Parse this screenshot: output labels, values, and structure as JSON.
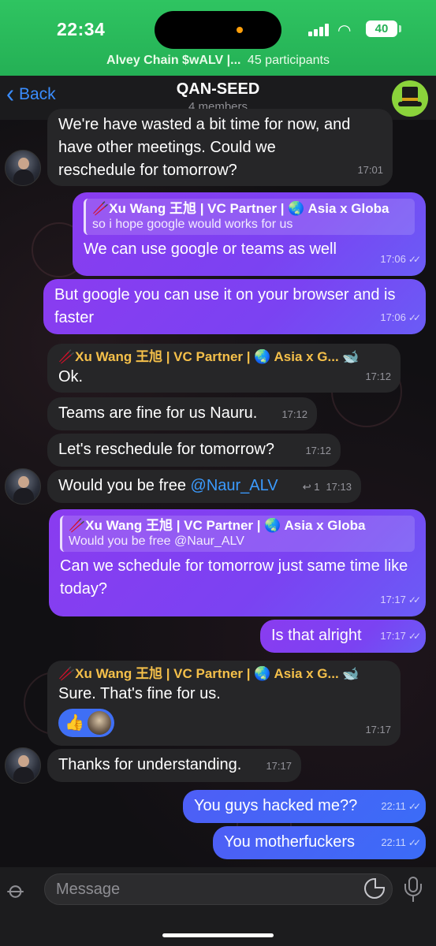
{
  "status_bar": {
    "time": "22:34",
    "battery": "40"
  },
  "call_banner": {
    "title": "Alvey Chain $wALV |...",
    "participants": "45 participants"
  },
  "header": {
    "back_label": "Back",
    "title": "QAN-SEED",
    "subtitle": "4 members"
  },
  "messages": [
    {
      "id": "m1",
      "text_line1": "We're have wasted a bit time for now, and",
      "text_rest": "have other meetings. Could we reschedule for tomorrow?",
      "time": "17:01"
    },
    {
      "id": "m2",
      "reply_name": "🥢Xu Wang 王旭 | VC Partner | 🌏 Asia x Globa",
      "reply_text": "so i hope google would works for us",
      "text": "We can use google or teams as well",
      "time": "17:06"
    },
    {
      "id": "m3",
      "text": "But google you can use it on your browser and is faster",
      "time": "17:06"
    },
    {
      "id": "m4",
      "sender": "🥢Xu Wang 王旭 | VC Partner | 🌏 Asia x G... 🐋",
      "text": "Ok.",
      "time": "17:12"
    },
    {
      "id": "m5",
      "text": "Teams are fine for us Nauru.",
      "time": "17:12"
    },
    {
      "id": "m6",
      "text": "Let's reschedule for tomorrow?",
      "time": "17:12"
    },
    {
      "id": "m7",
      "text": "Would you be free ",
      "mention": "@Naur_ALV",
      "reply_count": "↩ 1",
      "time": "17:13"
    },
    {
      "id": "m8",
      "reply_name": "🥢Xu Wang 王旭 | VC Partner | 🌏 Asia x Globa",
      "reply_text": "Would you be free @Naur_ALV",
      "text": "Can we schedule for tomorrow just same time like today?",
      "time": "17:17"
    },
    {
      "id": "m9",
      "text": "Is that alright",
      "time": "17:17"
    },
    {
      "id": "m10",
      "sender": "🥢Xu Wang 王旭 | VC Partner | 🌏 Asia x G... 🐋",
      "text": "Sure. That's fine for us.",
      "reaction": "👍",
      "time": "17:17"
    },
    {
      "id": "m11",
      "text": "Thanks for understanding.",
      "time": "17:17"
    },
    {
      "id": "m12",
      "text": "You guys hacked me??",
      "time": "22:11"
    },
    {
      "id": "m13",
      "text": "You motherfuckers",
      "time": "22:11"
    }
  ],
  "input": {
    "placeholder": "Message"
  },
  "icons": [
    "back-chevron-icon",
    "group-avatar-tophat-icon",
    "attach-paperclip-icon",
    "sticker-icon",
    "microphone-icon",
    "read-checks-icon"
  ],
  "colors": {
    "status_green": "#24b055",
    "outgoing_purple": "#7b42f2",
    "outgoing_blue": "#3b6cf7",
    "incoming": "#262628",
    "accent_blue": "#3a8dff",
    "sender_gold": "#f5c04a"
  }
}
